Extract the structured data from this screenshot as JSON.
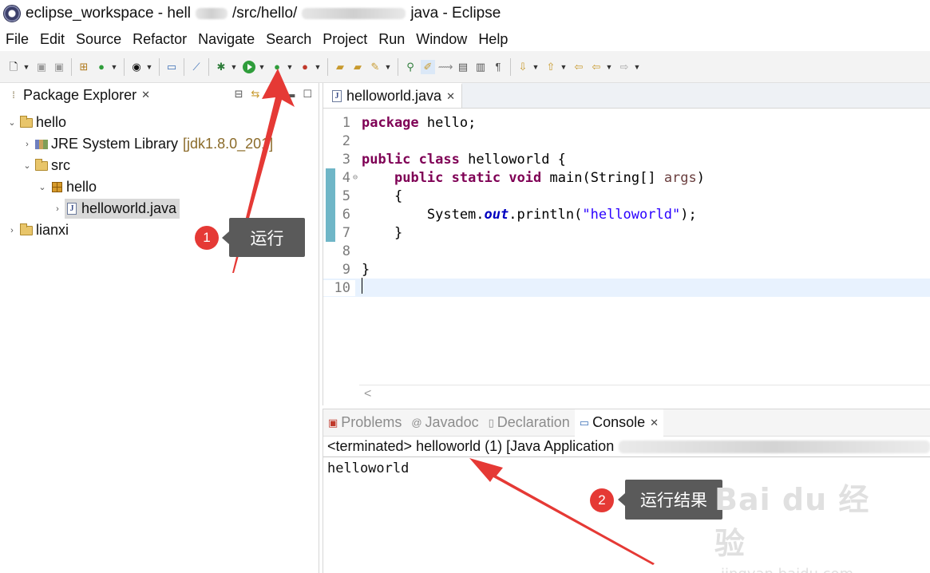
{
  "window": {
    "title_prefix": "eclipse_workspace - hell",
    "title_mid": "/src/hello/",
    "title_suffix": "java - Eclipse"
  },
  "menu": [
    "File",
    "Edit",
    "Source",
    "Refactor",
    "Navigate",
    "Search",
    "Project",
    "Run",
    "Window",
    "Help"
  ],
  "package_explorer": {
    "tab_label": "Package Explorer",
    "tree": {
      "project": "hello",
      "library": "JRE System Library",
      "library_decor": "[jdk1.8.0_201]",
      "src": "src",
      "package": "hello",
      "file": "helloworld.java",
      "project2": "lianxi"
    }
  },
  "editor": {
    "tab_label": "helloworld.java",
    "lines": {
      "l1": {
        "n": "1",
        "kw": "package",
        "rest": " hello;"
      },
      "l2": {
        "n": "2"
      },
      "l3": {
        "n": "3",
        "kw1": "public",
        "kw2": "class",
        "rest": " helloworld {"
      },
      "l4": {
        "n": "4",
        "indent": "    ",
        "kw1": "public",
        "kw2": "static",
        "kw3": "void",
        "mid": " main(String[] ",
        "param": "args",
        "end": ")"
      },
      "l5": {
        "n": "5",
        "text": "    {"
      },
      "l6": {
        "n": "6",
        "pre": "        System.",
        "field": "out",
        "mid": ".println(",
        "str": "\"helloworld\"",
        "end": ");"
      },
      "l7": {
        "n": "7",
        "text": "    }"
      },
      "l8": {
        "n": "8"
      },
      "l9": {
        "n": "9",
        "text": "}"
      },
      "l10": {
        "n": "10"
      }
    },
    "scroll_left_glyph": "<"
  },
  "console": {
    "tabs": {
      "problems": "Problems",
      "javadoc": "Javadoc",
      "declaration": "Declaration",
      "console": "Console"
    },
    "status_prefix": "<terminated> helloworld (1) [Java Application",
    "output": "helloworld"
  },
  "annotations": {
    "badge1": "1",
    "callout1": "运行",
    "badge2": "2",
    "callout2": "运行结果",
    "color_arrow": "#e53935"
  },
  "watermark": {
    "main": "Bai du 经验",
    "sub": "jingyan.baidu.com"
  }
}
